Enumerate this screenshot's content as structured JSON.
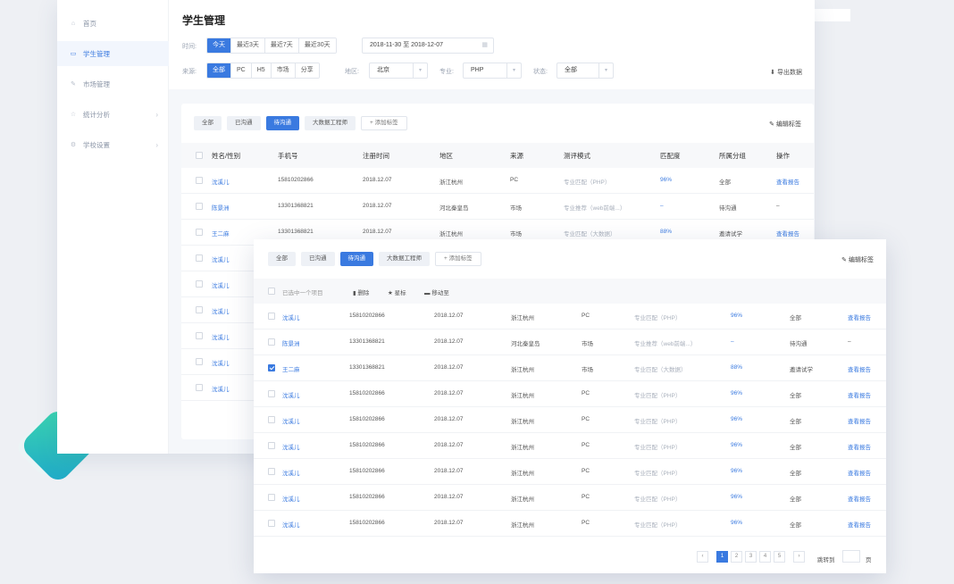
{
  "sidebar": {
    "items": [
      {
        "label": "首页",
        "icon": "home-icon",
        "glyph": "⌂",
        "active": false,
        "chevron": false
      },
      {
        "label": "学生管理",
        "icon": "card-icon",
        "glyph": "▭",
        "active": true,
        "chevron": false
      },
      {
        "label": "市场管理",
        "icon": "leaf-icon",
        "glyph": "✎",
        "active": false,
        "chevron": false
      },
      {
        "label": "统计分析",
        "icon": "star-icon",
        "glyph": "☆",
        "active": false,
        "chevron": true
      },
      {
        "label": "学校设置",
        "icon": "settings-icon",
        "glyph": "⚙",
        "active": false,
        "chevron": true
      }
    ]
  },
  "filter": {
    "title": "学生管理",
    "time_label": "时间:",
    "time_options": [
      "今天",
      "最近3天",
      "最近7天",
      "最近30天"
    ],
    "time_selected": 0,
    "date_range": "2018-11-30 至 2018-12-07",
    "source_label": "来源:",
    "source_options": [
      "全部",
      "PC",
      "H5",
      "市场",
      "分享"
    ],
    "source_selected": 0,
    "region_label": "地区:",
    "region_value": "北京",
    "major_label": "专业:",
    "major_value": "PHP",
    "status_label": "状态:",
    "status_value": "全部",
    "export_label": "导出数据"
  },
  "tags": [
    "全部",
    "已沟通",
    "待沟通",
    "大数据工程师"
  ],
  "tag_selected": 2,
  "add_tag": "添加标签",
  "edit_tag": "编辑标签",
  "columns": [
    "姓名/性别",
    "手机号",
    "注册时间",
    "地区",
    "来源",
    "测评模式",
    "匹配度",
    "所属分组",
    "操作"
  ],
  "rows_back": [
    {
      "name": "沈溪儿",
      "phone": "15810202866",
      "date": "2018.12.07",
      "region": "浙江杭州",
      "source": "PC",
      "mode": "专业匹配（PHP）",
      "match": "96%",
      "group": "全部",
      "action": "查看报告"
    },
    {
      "name": "陈景洲",
      "phone": "13301368821",
      "date": "2018.12.07",
      "region": "河北秦皇岛",
      "source": "市场",
      "mode": "专业推荐（web前端...）",
      "match": "–",
      "group": "待沟通",
      "action": "–"
    },
    {
      "name": "王二麻",
      "phone": "13301368821",
      "date": "2018.12.07",
      "region": "浙江杭州",
      "source": "市场",
      "mode": "专业匹配（大数据）",
      "match": "88%",
      "group": "邀请试学",
      "action": "查看报告"
    },
    {
      "name": "沈溪儿"
    },
    {
      "name": "沈溪儿"
    },
    {
      "name": "沈溪儿"
    },
    {
      "name": "沈溪儿"
    },
    {
      "name": "沈溪儿"
    },
    {
      "name": "沈溪儿"
    }
  ],
  "bulk": {
    "selected_label": "已选中一个项目",
    "delete_label": "删除",
    "star_label": "星标",
    "move_label": "移动至"
  },
  "rows_front": [
    {
      "name": "沈溪儿",
      "phone": "15810202866",
      "date": "2018.12.07",
      "region": "浙江杭州",
      "source": "PC",
      "mode": "专业匹配（PHP）",
      "match": "96%",
      "group": "全部",
      "action": "查看报告",
      "checked": false
    },
    {
      "name": "陈景洲",
      "phone": "13301368821",
      "date": "2018.12.07",
      "region": "河北秦皇岛",
      "source": "市场",
      "mode": "专业推荐（web前端...）",
      "match": "–",
      "group": "待沟通",
      "action": "–",
      "checked": false
    },
    {
      "name": "王二麻",
      "phone": "13301368821",
      "date": "2018.12.07",
      "region": "浙江杭州",
      "source": "市场",
      "mode": "专业匹配（大数据）",
      "match": "88%",
      "group": "邀请试学",
      "action": "查看报告",
      "checked": true
    },
    {
      "name": "沈溪儿",
      "phone": "15810202866",
      "date": "2018.12.07",
      "region": "浙江杭州",
      "source": "PC",
      "mode": "专业匹配（PHP）",
      "match": "96%",
      "group": "全部",
      "action": "查看报告",
      "checked": false
    },
    {
      "name": "沈溪儿",
      "phone": "15810202866",
      "date": "2018.12.07",
      "region": "浙江杭州",
      "source": "PC",
      "mode": "专业匹配（PHP）",
      "match": "96%",
      "group": "全部",
      "action": "查看报告",
      "checked": false
    },
    {
      "name": "沈溪儿",
      "phone": "15810202866",
      "date": "2018.12.07",
      "region": "浙江杭州",
      "source": "PC",
      "mode": "专业匹配（PHP）",
      "match": "96%",
      "group": "全部",
      "action": "查看报告",
      "checked": false
    },
    {
      "name": "沈溪儿",
      "phone": "15810202866",
      "date": "2018.12.07",
      "region": "浙江杭州",
      "source": "PC",
      "mode": "专业匹配（PHP）",
      "match": "96%",
      "group": "全部",
      "action": "查看报告",
      "checked": false
    },
    {
      "name": "沈溪儿",
      "phone": "15810202866",
      "date": "2018.12.07",
      "region": "浙江杭州",
      "source": "PC",
      "mode": "专业匹配（PHP）",
      "match": "96%",
      "group": "全部",
      "action": "查看报告",
      "checked": false
    },
    {
      "name": "沈溪儿",
      "phone": "15810202866",
      "date": "2018.12.07",
      "region": "浙江杭州",
      "source": "PC",
      "mode": "专业匹配（PHP）",
      "match": "96%",
      "group": "全部",
      "action": "查看报告",
      "checked": false
    }
  ],
  "pager": {
    "pages": [
      "1",
      "2",
      "3",
      "4",
      "5"
    ],
    "current": 0,
    "prev": "‹",
    "next": "›",
    "jump_label": "跳转到",
    "page_suffix": "页"
  },
  "colors": {
    "accent": "#3a7ae0",
    "teal": "#3bd6b0"
  }
}
